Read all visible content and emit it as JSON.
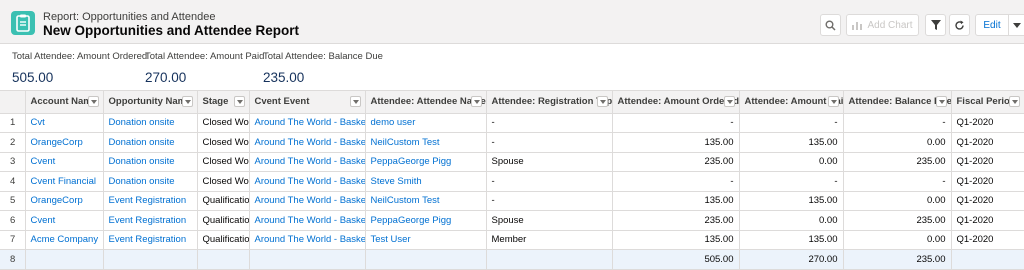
{
  "header": {
    "breadcrumb": "Report: Opportunities and Attendee",
    "title": "New Opportunities and Attendee Report",
    "add_chart_label": "Add Chart",
    "edit_label": "Edit"
  },
  "summary": [
    {
      "label": "Total Attendee: Amount Ordered",
      "value": "505.00"
    },
    {
      "label": "Total Attendee: Amount Paid",
      "value": "270.00"
    },
    {
      "label": "Total Attendee: Balance Due",
      "value": "235.00"
    }
  ],
  "table": {
    "columns": [
      "",
      "Account Name",
      "Opportunity Name",
      "Stage",
      "Cvent Event",
      "Attendee: Attendee Name",
      "Attendee: Registration Type",
      "Attendee: Amount Ordered",
      "Attendee: Amount Paid",
      "Attendee: Balance Due",
      "Fiscal Period"
    ],
    "rows": [
      [
        "1",
        "Cvt",
        "Donation onsite",
        "Closed Won",
        "Around The World - Basketball",
        "demo user",
        "-",
        "-",
        "-",
        "-",
        "Q1-2020"
      ],
      [
        "2",
        "OrangeCorp",
        "Donation onsite",
        "Closed Won",
        "Around The World - Basketball",
        "NeilCustom Test",
        "-",
        "135.00",
        "135.00",
        "0.00",
        "Q1-2020"
      ],
      [
        "3",
        "Cvent",
        "Donation onsite",
        "Closed Won",
        "Around The World - Basketball",
        "PeppaGeorge Pigg",
        "Spouse",
        "235.00",
        "0.00",
        "235.00",
        "Q1-2020"
      ],
      [
        "4",
        "Cvent Financial",
        "Donation onsite",
        "Closed Won",
        "Around The World - Basketball",
        "Steve Smith",
        "-",
        "-",
        "-",
        "-",
        "Q1-2020"
      ],
      [
        "5",
        "OrangeCorp",
        "Event Registration",
        "Qualification",
        "Around The World - Basketball",
        "NeilCustom Test",
        "-",
        "135.00",
        "135.00",
        "0.00",
        "Q1-2020"
      ],
      [
        "6",
        "Cvent",
        "Event Registration",
        "Qualification",
        "Around The World - Basketball",
        "PeppaGeorge Pigg",
        "Spouse",
        "235.00",
        "0.00",
        "235.00",
        "Q1-2020"
      ],
      [
        "7",
        "Acme Company",
        "Event Registration",
        "Qualification",
        "Around The World - Basketball",
        "Test User",
        "Member",
        "135.00",
        "135.00",
        "0.00",
        "Q1-2020"
      ],
      [
        "8",
        "",
        "",
        "",
        "",
        "",
        "",
        "505.00",
        "270.00",
        "235.00",
        ""
      ]
    ]
  },
  "colors": {
    "header_bg": "#f3f2f2",
    "report_icon": "#3bc0b2",
    "link": "#0070d2",
    "summary_value": "#16325c",
    "total_row_bg": "#ecf3fb"
  }
}
